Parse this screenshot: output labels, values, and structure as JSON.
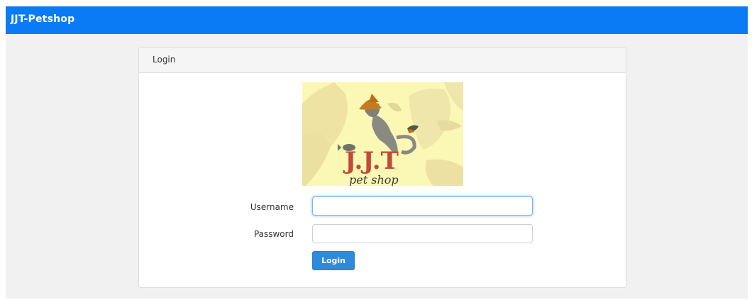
{
  "navbar": {
    "brand": "JJT-Petshop"
  },
  "panel": {
    "title": "Login"
  },
  "logo": {
    "text_main": "J.J.T",
    "text_sub": "pet shop"
  },
  "form": {
    "username_label": "Username",
    "username_value": "",
    "password_label": "Password",
    "password_value": "",
    "submit_label": "Login"
  },
  "colors": {
    "navbar": "#0b7bf5",
    "button": "#2e8bdc",
    "logo_bg": "#fbf7b4"
  }
}
